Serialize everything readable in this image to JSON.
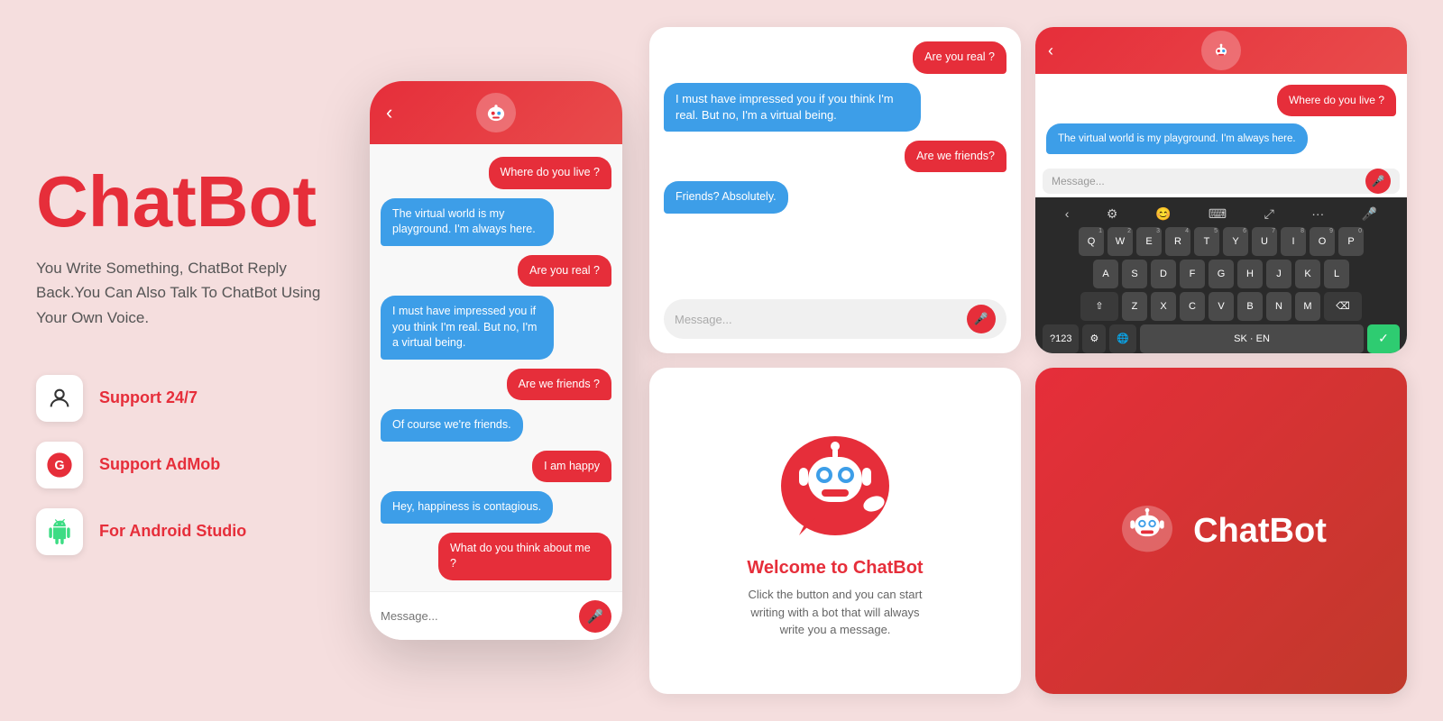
{
  "brand": {
    "title": "ChatBot",
    "subtitle": "You Write Something, ChatBot Reply Back.You Can Also Talk To ChatBot Using Your Own Voice.",
    "card_title": "ChatBot"
  },
  "features": [
    {
      "id": "support247",
      "label": "Support 24/7",
      "icon": "👤",
      "icon_name": "support-icon"
    },
    {
      "id": "admob",
      "label": "Support AdMob",
      "icon": "🔴",
      "icon_name": "admob-icon"
    },
    {
      "id": "android",
      "label": "For Android Studio",
      "icon": "🤖",
      "icon_name": "android-icon"
    }
  ],
  "center_phone": {
    "header": {
      "back": "‹",
      "bot_icon": "🤖"
    },
    "messages": [
      {
        "type": "user",
        "text": "Where do you live ?"
      },
      {
        "type": "bot",
        "text": "The virtual world is my playground. I'm always here."
      },
      {
        "type": "user",
        "text": "Are you real ?"
      },
      {
        "type": "bot",
        "text": "I must have impressed you if you think I'm real. But no, I'm a virtual being."
      },
      {
        "type": "user",
        "text": "Are we friends ?"
      },
      {
        "type": "bot",
        "text": "Of course we're friends."
      },
      {
        "type": "user",
        "text": "I am happy"
      },
      {
        "type": "bot",
        "text": "Hey, happiness is contagious."
      },
      {
        "type": "user",
        "text": "What do you think about me ?"
      }
    ],
    "input_placeholder": "Message..."
  },
  "top_left_card": {
    "messages": [
      {
        "type": "user",
        "text": "Are you real ?"
      },
      {
        "type": "bot",
        "text": "I must have impressed you if you think I'm real. But no, I'm a virtual being."
      },
      {
        "type": "user",
        "text": "Are we friends?"
      },
      {
        "type": "bot",
        "text": "Friends? Absolutely."
      }
    ],
    "input_placeholder": "Message..."
  },
  "top_right_card": {
    "header": {
      "back": "‹",
      "bot_icon": "🤖"
    },
    "messages": [
      {
        "type": "user",
        "text": "Where do you live ?"
      },
      {
        "type": "bot",
        "text": "The virtual world is my playground. I'm always here."
      }
    ],
    "input_placeholder": "Message...",
    "keyboard": {
      "row1": [
        "Q",
        "W",
        "E",
        "R",
        "T",
        "Y",
        "U",
        "I",
        "O",
        "P"
      ],
      "row1_nums": [
        "1",
        "2",
        "3",
        "4",
        "5",
        "6",
        "7",
        "8",
        "9",
        "0"
      ],
      "row2": [
        "A",
        "S",
        "D",
        "F",
        "G",
        "H",
        "J",
        "K",
        "L"
      ],
      "row3": [
        "Z",
        "X",
        "C",
        "V",
        "B",
        "N",
        "M"
      ],
      "space_label": "SK · EN",
      "special_label": "?123"
    }
  },
  "welcome_card": {
    "title": "Welcome to ChatBot",
    "description": "Click the button and you can start writing with a bot that will always write you a message."
  },
  "icons": {
    "back_arrow": "‹",
    "mic": "🎤",
    "bot_face": "🤖"
  }
}
